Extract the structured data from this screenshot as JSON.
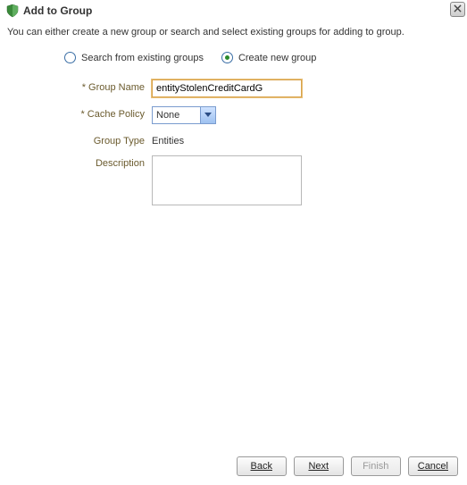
{
  "header": {
    "title": "Add to Group"
  },
  "intro": "You can either create a new group or search and select existing groups for adding to group.",
  "options": {
    "search_label": "Search from existing groups",
    "create_label": "Create new group",
    "selected": "create"
  },
  "form": {
    "group_name": {
      "label": "* Group Name",
      "value": "entityStolenCreditCardG"
    },
    "cache_policy": {
      "label": "* Cache Policy",
      "value": "None"
    },
    "group_type": {
      "label": "Group Type",
      "value": "Entities"
    },
    "description": {
      "label": "Description",
      "value": ""
    }
  },
  "buttons": {
    "back": "Back",
    "next": "Next",
    "finish": "Finish",
    "cancel": "Cancel"
  }
}
